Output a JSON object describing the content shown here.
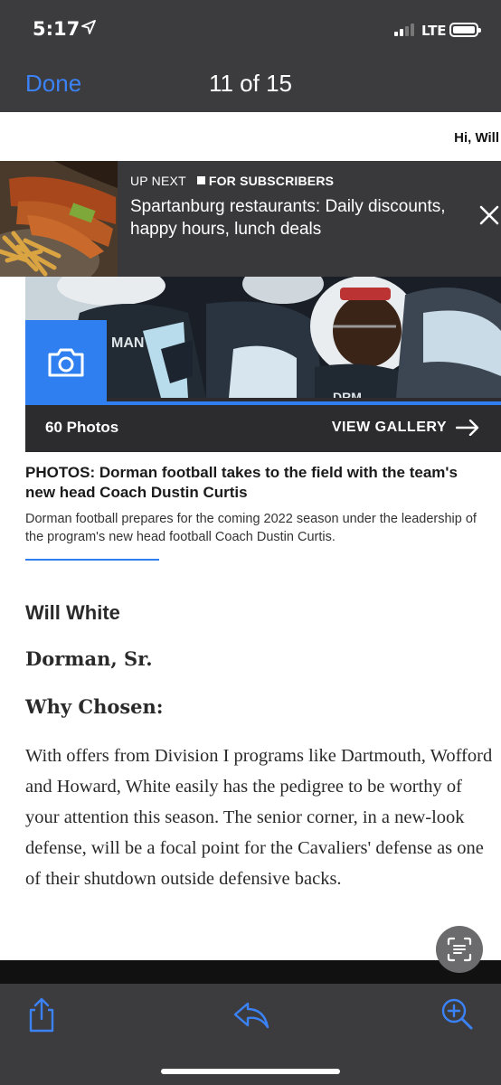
{
  "status": {
    "time": "5:17",
    "network": "LTE"
  },
  "nav": {
    "done_label": "Done",
    "title": "11 of 15"
  },
  "greeting": "Hi, Will",
  "upnext": {
    "kicker": "UP NEXT",
    "badge": "FOR SUBSCRIBERS",
    "title": "Spartanburg restaurants: Daily discounts, happy hours, lunch deals"
  },
  "gallery": {
    "count": "60 Photos",
    "view_label": "VIEW GALLERY"
  },
  "caption": {
    "title": "PHOTOS: Dorman football takes to the field with the team's new head Coach Dustin Curtis",
    "desc": "Dorman football prepares for the coming 2022 season under the leadership of the program's new head football Coach Dustin Curtis."
  },
  "article": {
    "name": "Will White",
    "school": "Dorman, Sr.",
    "why": "Why Chosen:",
    "body": "With offers from Division I programs like Dartmouth, Wofford and Howard, White easily has the pedigree to be worthy of your attention this season. The senior corner, in a new-look defense, will be a focal point for the Cavaliers' defense as one of their shutdown outside defensive backs."
  },
  "colors": {
    "accent": "#3b82f6",
    "chrome": "#3c3c3e",
    "gallery_blue": "#2f7ff0"
  },
  "icons": [
    "location-arrow-icon",
    "camera-icon",
    "arrow-right-icon",
    "close-icon",
    "share-icon",
    "reply-icon",
    "zoom-in-icon",
    "text-scan-icon"
  ]
}
